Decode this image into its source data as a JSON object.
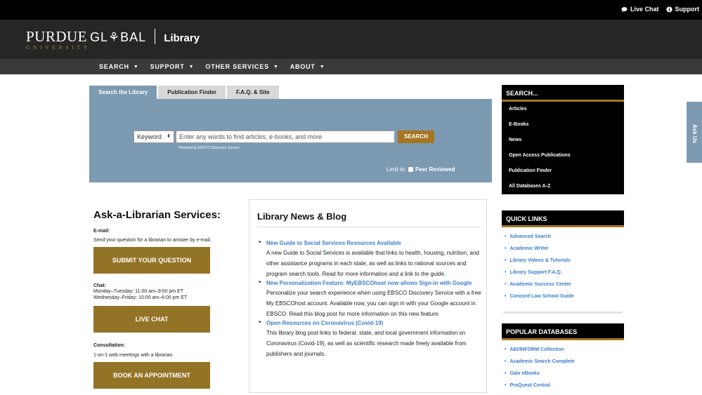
{
  "utility": {
    "live_chat": "Live Chat",
    "support": "Support"
  },
  "brand": {
    "purdue": "PURDUE",
    "global": "GL⚘BAL",
    "university": "UNIVERSITY.",
    "library": "Library"
  },
  "nav": {
    "items": [
      {
        "label": "SEARCH"
      },
      {
        "label": "SUPPORT"
      },
      {
        "label": "OTHER SERVICES"
      },
      {
        "label": "ABOUT"
      }
    ]
  },
  "search_tabs": {
    "tabs": [
      {
        "label": "Search the Library"
      },
      {
        "label": "Publication Finder"
      },
      {
        "label": "F.A.Q. & Site"
      }
    ]
  },
  "search_panel": {
    "select_value": "Keyword",
    "placeholder": "Enter any words to find articles, e-books, and more",
    "button": "SEARCH",
    "powered": "Powered by EBSCO Discovery Service",
    "limit_label": "Limit to:",
    "limit_option": "Peer Reviewed"
  },
  "ask": {
    "title": "Ask-a-Librarian Services:",
    "email_label": "E-mail:",
    "email_text": "Send your question for a librarian to answer by e-mail.",
    "submit_button": "SUBMIT YOUR QUESTION",
    "chat_label": "Chat:",
    "chat_hours_1": "Monday–Tuesday: 11:00 am–9:00 pm ET",
    "chat_hours_2": "Wednesday–Friday: 10:00 am–6:00 pm ET",
    "chat_button": "LIVE CHAT",
    "consult_label": "Consultation:",
    "consult_text": "1-on-1 web meetings with a librarian.",
    "appointment_button": "BOOK AN APPOINTMENT"
  },
  "news": {
    "title": "Library News & Blog",
    "items": [
      {
        "title": "New Guide to Social Services Resources Available",
        "body": "A new Guide to Social Services is available that links to health, housing, nutrition, and other assistance programs in each state, as well as links to national sources and program search tools. Read for more information and a link to the guide."
      },
      {
        "title": "New Personalization Feature: MyEBSCOhost now allows Sign-in with Google",
        "body": "Personalize your search experience when using EBSCO Discovery Service with a free My EBSCOhost account. Available now, you can sign in with your Google account in EBSCO. Read this blog post for more information on this new feature."
      },
      {
        "title": "Open Resources on Coronavirus (Covid-19)",
        "body": "This library blog post links to federal, state, and local government information on Coronavirus (Covid-19), as well as scientific research made freely available from publishers and journals."
      }
    ]
  },
  "sidebar": {
    "search_title": "SEARCH...",
    "search_items": [
      {
        "label": "Articles"
      },
      {
        "label": "E-Books"
      },
      {
        "label": "News"
      },
      {
        "label": "Open Access Publications"
      },
      {
        "label": "Publication Finder"
      },
      {
        "label": "All Databases A-Z"
      }
    ],
    "quick_title": "QUICK LINKS",
    "quick_links": [
      {
        "label": "Advanced Search"
      },
      {
        "label": "Academic Writer"
      },
      {
        "label": "Library Videos & Tutorials"
      },
      {
        "label": "Library Support F.A.Q."
      },
      {
        "label": "Academic Success Center"
      },
      {
        "label": "Concord Law School Guide"
      }
    ],
    "popular_title": "POPULAR DATABASES",
    "popular_links": [
      {
        "label": "ABI/INFORM Collection"
      },
      {
        "label": "Academic Search Complete"
      },
      {
        "label": "Gale eBooks"
      },
      {
        "label": "ProQuest Central"
      }
    ]
  },
  "ask_us": "Ask Us",
  "colors": {
    "gold": "#937325",
    "panel_blue": "#7d9ab3",
    "link_blue": "#3d7cc9"
  }
}
